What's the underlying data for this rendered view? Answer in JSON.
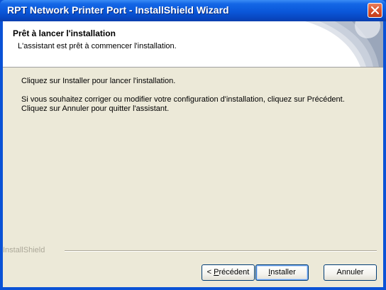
{
  "window": {
    "title": "RPT Network Printer Port - InstallShield Wizard"
  },
  "header": {
    "title": "Prêt à lancer l'installation",
    "subtitle": "L'assistant est prêt à commencer l'installation."
  },
  "body": {
    "line1": "Cliquez sur Installer pour lancer l'installation.",
    "line2": "Si vous souhaitez corriger ou modifier votre configuration d'installation, cliquez sur Précédent.",
    "line3": "Cliquez sur Annuler pour quitter l'assistant."
  },
  "footer": {
    "brand": "InstallShield"
  },
  "buttons": {
    "back": {
      "prefix": "< ",
      "mnemonic": "P",
      "rest": "récédent"
    },
    "install": {
      "mnemonic": "I",
      "rest": "nstaller"
    },
    "cancel": {
      "label": "Annuler"
    }
  },
  "colors": {
    "titlebar": "#0a57d9",
    "dialog_face": "#ece9d8",
    "close_button": "#d8522c"
  },
  "icons": {
    "close": "close-icon",
    "header_graphic": "swoosh-graphic"
  }
}
